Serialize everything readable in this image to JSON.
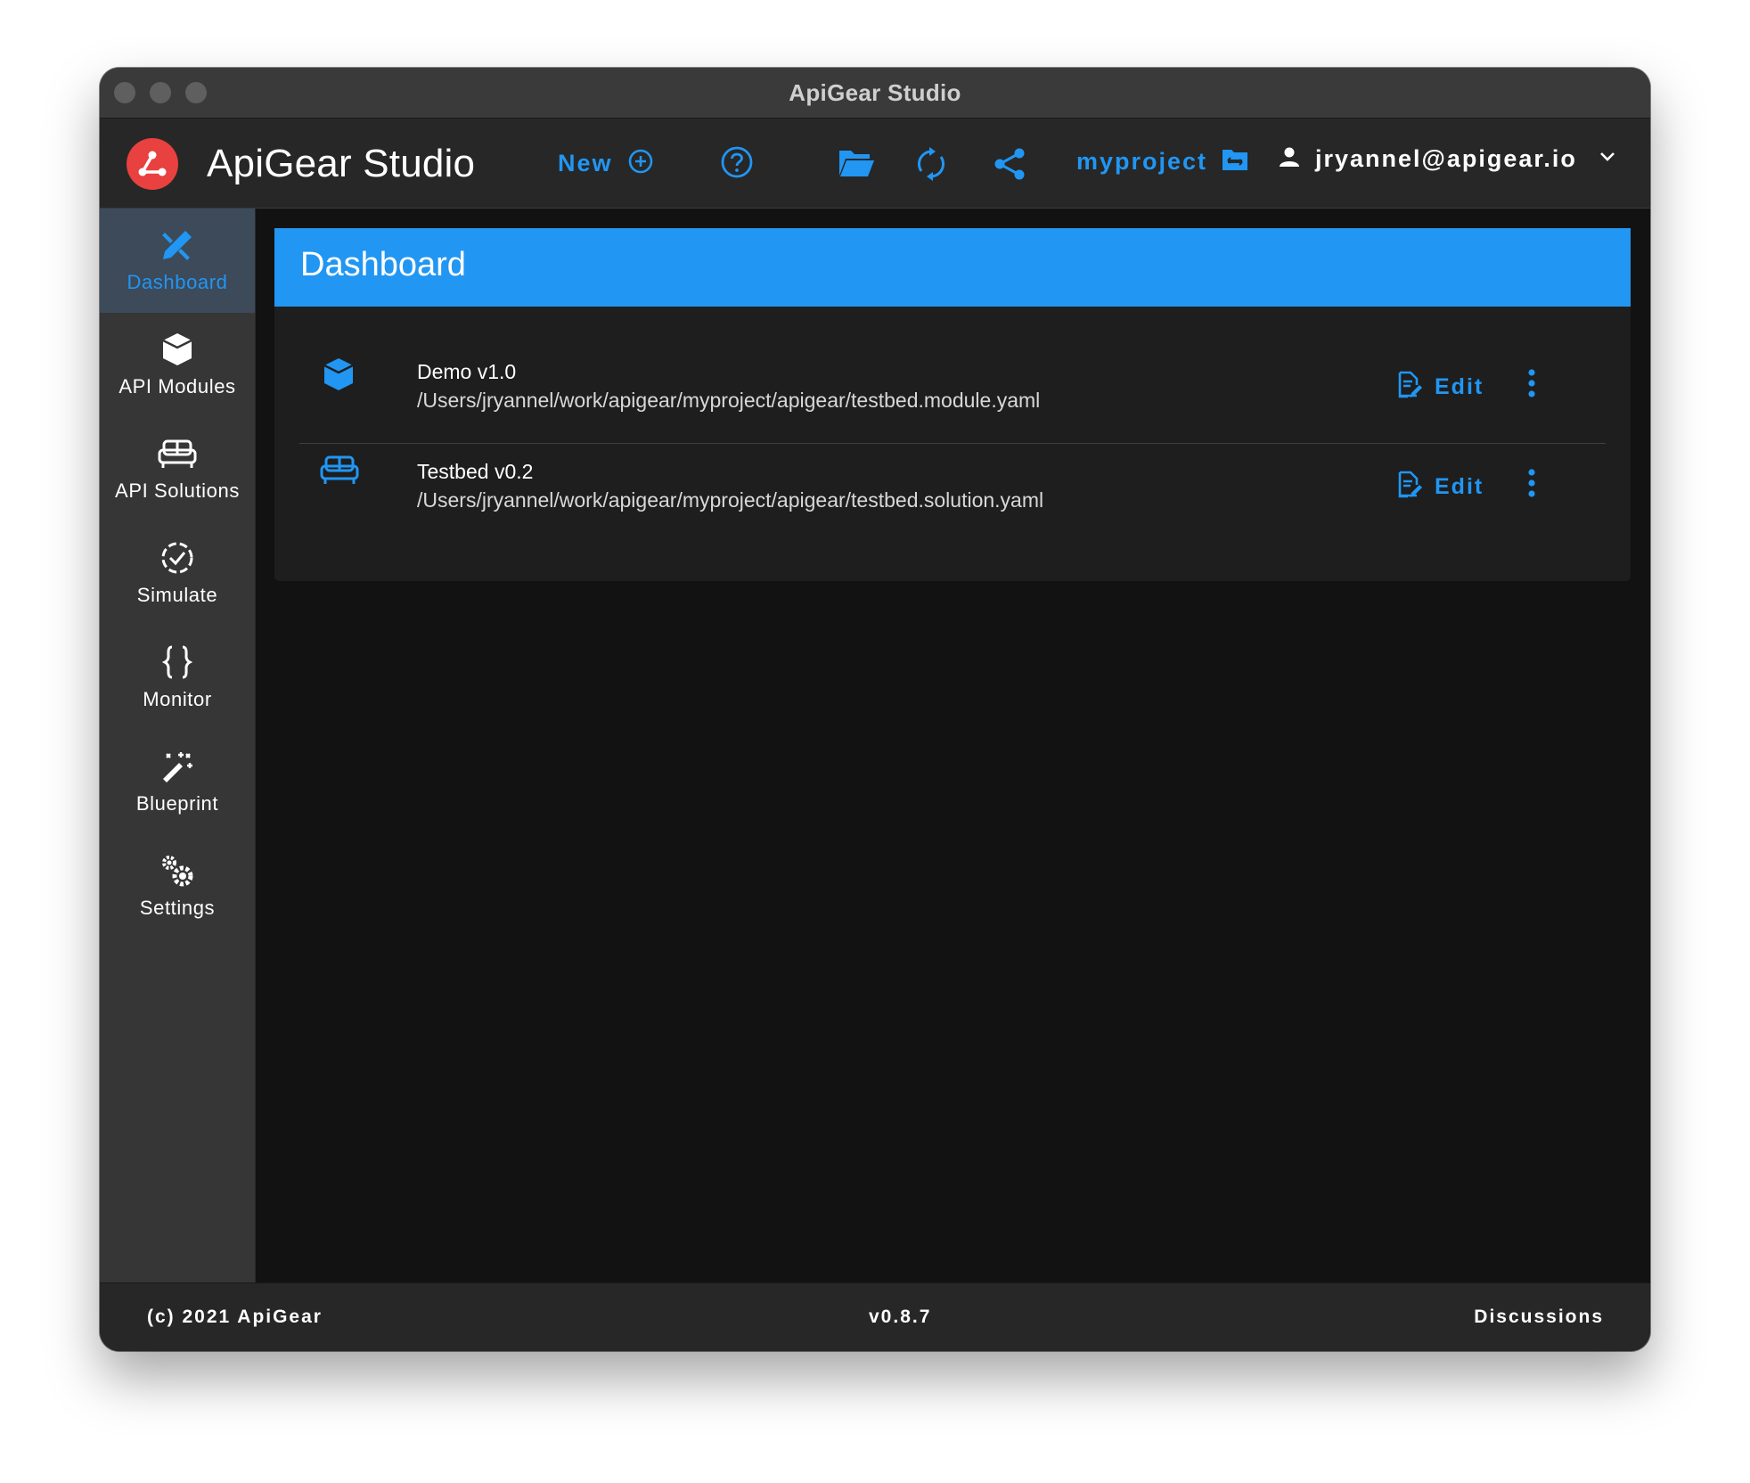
{
  "window": {
    "title": "ApiGear Studio"
  },
  "appbar": {
    "app_name": "ApiGear Studio",
    "logo_icon": "apigear-logo-icon",
    "new_label": "New",
    "new_icon": "plus-circle-icon",
    "help_icon": "help-circle-icon",
    "open_folder_icon": "folder-open-icon",
    "sync_icon": "sync-icon",
    "share_icon": "share-icon",
    "project_name": "myproject",
    "project_icon": "folder-swap-icon",
    "user_icon": "account-icon",
    "user_email": "jryannel@apigear.io",
    "user_menu_icon": "chevron-down-icon"
  },
  "sidebar": {
    "items": [
      {
        "label": "Dashboard",
        "icon": "pencil-ruler-icon",
        "active": true
      },
      {
        "label": "API Modules",
        "icon": "cube-icon",
        "active": false
      },
      {
        "label": "API Solutions",
        "icon": "sofa-icon",
        "active": false
      },
      {
        "label": "Simulate",
        "icon": "check-circle-dashed-icon",
        "active": false
      },
      {
        "label": "Monitor",
        "icon": "code-braces-icon",
        "active": false
      },
      {
        "label": "Blueprint",
        "icon": "magic-wand-icon",
        "active": false
      },
      {
        "label": "Settings",
        "icon": "cogs-icon",
        "active": false
      }
    ]
  },
  "main": {
    "title": "Dashboard",
    "items": [
      {
        "title": "Demo v1.0",
        "path": "/Users/jryannel/work/apigear/myproject/apigear/testbed.module.yaml",
        "icon": "cube-icon",
        "edit_label": "Edit"
      },
      {
        "title": "Testbed v0.2",
        "path": "/Users/jryannel/work/apigear/myproject/apigear/testbed.solution.yaml",
        "icon": "sofa-icon",
        "edit_label": "Edit"
      }
    ]
  },
  "footer": {
    "copyright": "(c) 2021 ApiGear",
    "version": "v0.8.7",
    "discussions": "Discussions"
  },
  "colors": {
    "accent": "#2196f3",
    "logo_red": "#e8413f",
    "sidebar_bg": "#363636",
    "content_bg": "#121212"
  }
}
